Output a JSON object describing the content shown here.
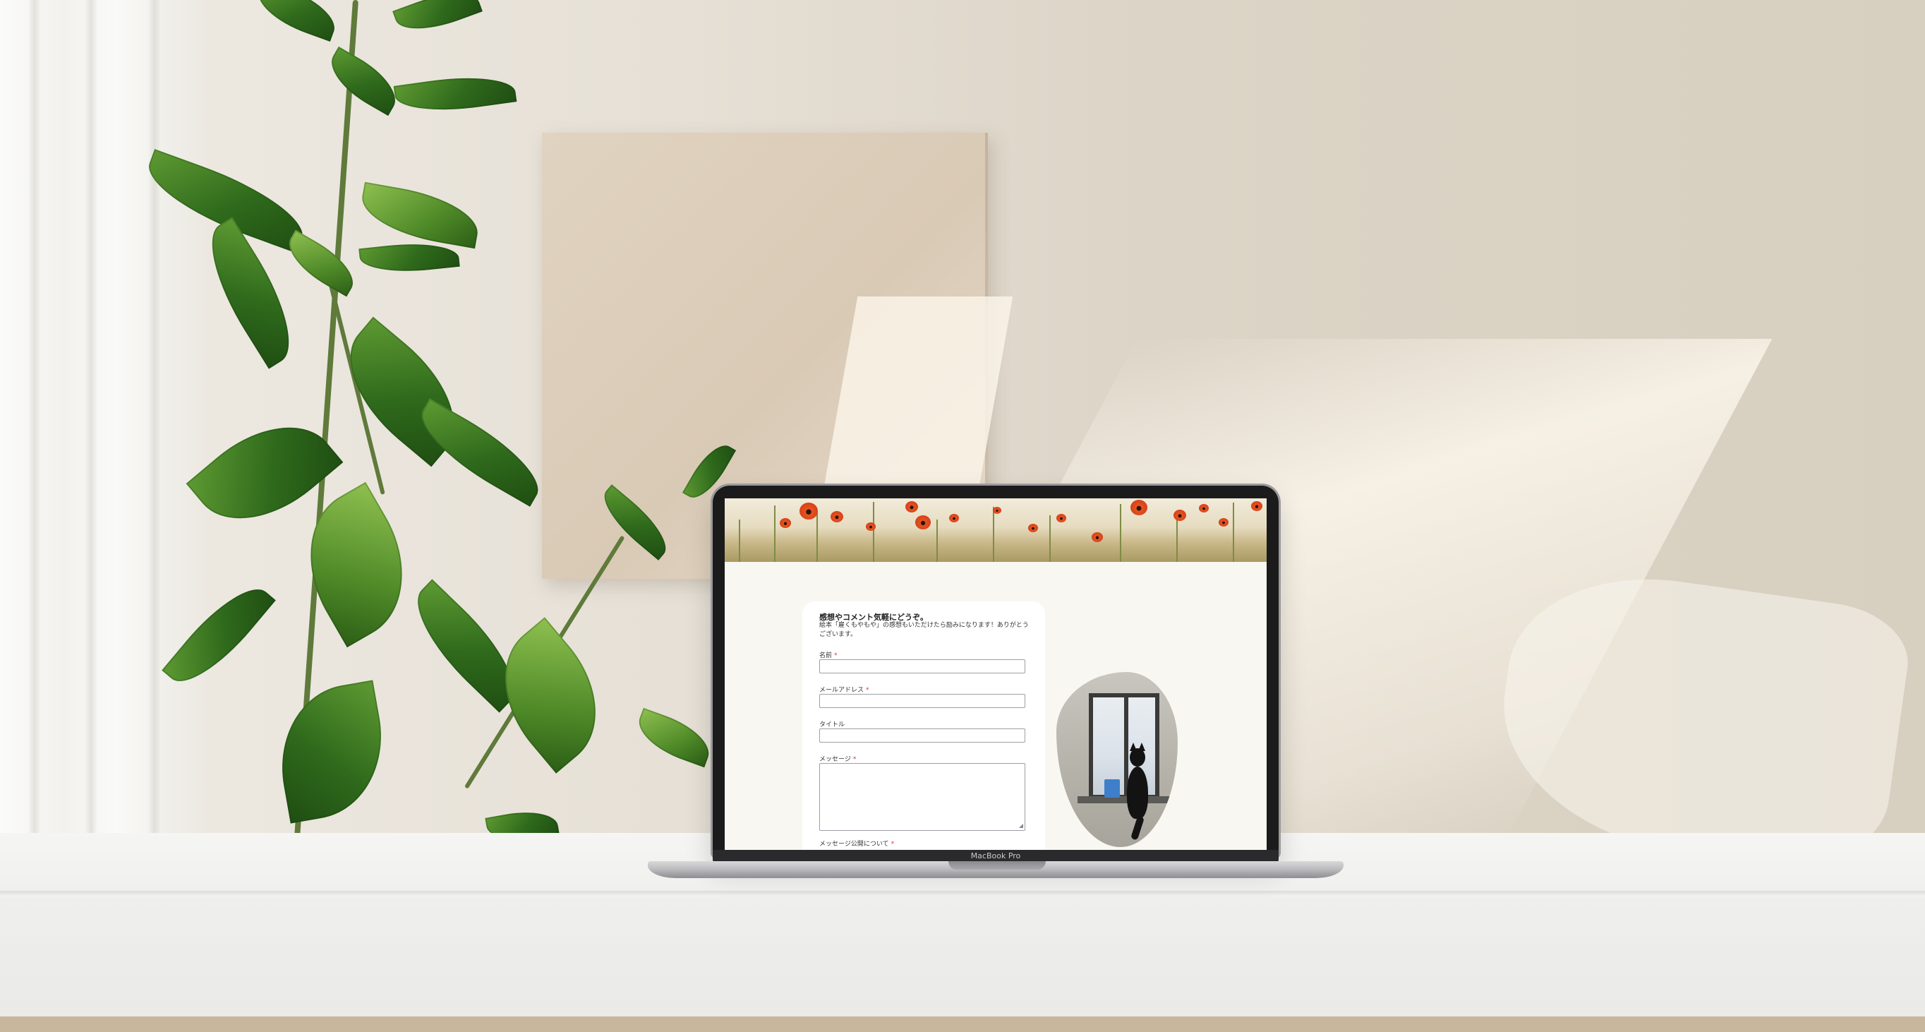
{
  "laptop": {
    "model_label": "MacBook Pro"
  },
  "form": {
    "heading": "感想やコメント気軽にどうぞ。",
    "intro": "絵本「雇くもやもや」の感想もいただけたら励みになります！ありがとうございます。",
    "required_mark": "*",
    "fields": [
      {
        "label": "名前",
        "required": true,
        "type": "text",
        "value": ""
      },
      {
        "label": "メールアドレス",
        "required": true,
        "type": "email",
        "value": ""
      },
      {
        "label": "タイトル",
        "required": false,
        "type": "text",
        "value": ""
      },
      {
        "label": "メッセージ",
        "required": true,
        "type": "textarea",
        "value": ""
      },
      {
        "label": "メッセージ公開について",
        "required": true,
        "type": "choice"
      }
    ]
  },
  "icons": {
    "banner": "poppy-field-image",
    "photo": "black-cat-window-photo",
    "resize": "textarea-resize-handle"
  },
  "colors": {
    "page_background": "#f9f7f2",
    "card_background": "#ffffff",
    "required": "#dd3333"
  }
}
